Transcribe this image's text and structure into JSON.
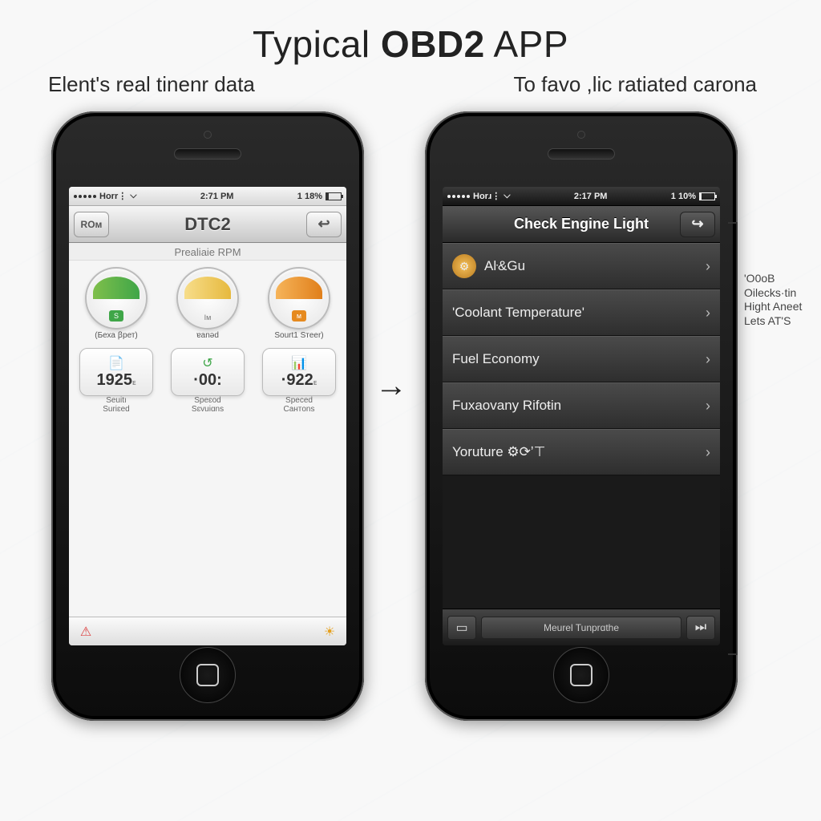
{
  "header": {
    "title_pre": "Typical ",
    "title_bold": "OBD2",
    "title_post": " APP",
    "subtitle_left": "Elent's real tinenr data",
    "subtitle_right": "To favo ,lic ratiated carona"
  },
  "colors": {
    "accent_green": "#3fa648",
    "accent_orange": "#e68a1f",
    "accent_yellow": "#f4c04d"
  },
  "phone1": {
    "statusbar": {
      "carrier": "Horr⋮",
      "time": "2:71 PM",
      "battery_label": "1 18%",
      "battery_fill": 18
    },
    "nav": {
      "left_label": "ROм",
      "title": "DTC2",
      "right_icon": "back-arrow"
    },
    "section_label": "Prealiaie RPM",
    "gauges_top": [
      {
        "color": "green",
        "caption": "(Беха ꞵрет)",
        "badge": "S"
      },
      {
        "color": "yellow",
        "caption": "ɐanəd",
        "badge": "Iм"
      },
      {
        "color": "orange",
        "caption": "Sourt1 Sтeer)",
        "badge": "м"
      }
    ],
    "gauges_bottom": [
      {
        "value": "1925",
        "sub": "ᴇ",
        "label1": "Seuitı",
        "label2": "Suriɛed",
        "icon": "📄"
      },
      {
        "value": "·00:",
        "sub": "",
        "label1": "Speɛod",
        "label2": "Sɛvuiɑns",
        "icon": "🔁"
      },
      {
        "value": "·922",
        "sub": "ᴇ",
        "label1": "Speced",
        "label2": "Cантons",
        "icon": "📊"
      }
    ],
    "toolbar": {
      "left_icon": "warning-icon",
      "right_icon": "sun-icon"
    }
  },
  "phone2": {
    "statusbar": {
      "carrier": "Horɹ⋮",
      "time": "2:17 PM",
      "battery_label": "1 10%",
      "battery_fill": 10
    },
    "nav": {
      "title": "Check Engine Light",
      "right_icon": "share-arrow"
    },
    "rows": [
      {
        "icon": true,
        "label": "Aŀ&Gu"
      },
      {
        "icon": false,
        "label": "'Coolant Temperature'"
      },
      {
        "icon": false,
        "label": "Fuel Economy"
      },
      {
        "icon": false,
        "label": "Fuxaovany Rifoŧin"
      },
      {
        "icon": false,
        "label": "Yoruture ⚙⟳ʼ⊤"
      }
    ],
    "tabbar": {
      "left_icon": "square-icon",
      "center_label": "Meurel Tunprɑthe",
      "right_icon": "step-icon"
    }
  },
  "annotation": {
    "arrow": "→",
    "right_text": "'O0ᴏB Oilecks·tin Hight Aneet Lets AT'S"
  }
}
